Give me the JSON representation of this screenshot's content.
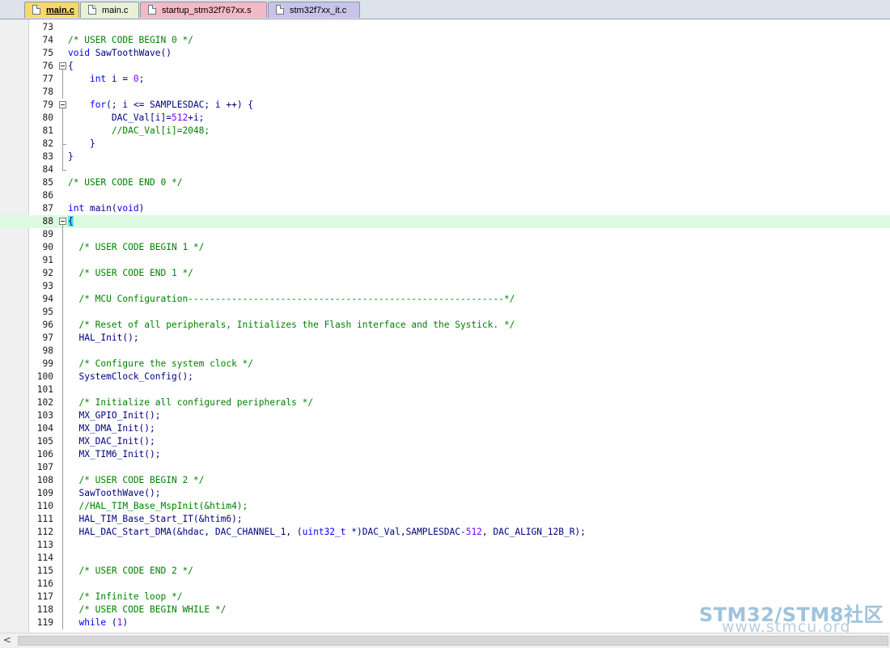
{
  "tabs": [
    {
      "label": "main.c",
      "active": true,
      "color": "#f6d96b"
    },
    {
      "label": "main.c",
      "active": false,
      "color": "#e8f1d6"
    },
    {
      "label": "startup_stm32f767xx.s",
      "active": false,
      "color": "#f4b9c6"
    },
    {
      "label": "stm32f7xx_it.c",
      "active": false,
      "color": "#c9c3ea"
    }
  ],
  "editor": {
    "current_line": 88,
    "lines": [
      {
        "n": "73",
        "t": ""
      },
      {
        "n": "74",
        "t": "/* USER CODE BEGIN 0 */"
      },
      {
        "n": "75",
        "t": "void SawToothWave()"
      },
      {
        "n": "76",
        "t": "{"
      },
      {
        "n": "77",
        "t": "    int i = 0;"
      },
      {
        "n": "78",
        "t": ""
      },
      {
        "n": "79",
        "t": "    for(; i <= SAMPLESDAC; i ++) {"
      },
      {
        "n": "80",
        "t": "        DAC_Val[i]=512+i;"
      },
      {
        "n": "81",
        "t": "        //DAC_Val[i]=2048;"
      },
      {
        "n": "82",
        "t": "    }"
      },
      {
        "n": "83",
        "t": "}"
      },
      {
        "n": "84",
        "t": ""
      },
      {
        "n": "85",
        "t": "/* USER CODE END 0 */"
      },
      {
        "n": "86",
        "t": ""
      },
      {
        "n": "87",
        "t": "int main(void)"
      },
      {
        "n": "88",
        "t": "{"
      },
      {
        "n": "89",
        "t": ""
      },
      {
        "n": "90",
        "t": "  /* USER CODE BEGIN 1 */"
      },
      {
        "n": "91",
        "t": ""
      },
      {
        "n": "92",
        "t": "  /* USER CODE END 1 */"
      },
      {
        "n": "93",
        "t": ""
      },
      {
        "n": "94",
        "t": "  /* MCU Configuration----------------------------------------------------------*/"
      },
      {
        "n": "95",
        "t": ""
      },
      {
        "n": "96",
        "t": "  /* Reset of all peripherals, Initializes the Flash interface and the Systick. */"
      },
      {
        "n": "97",
        "t": "  HAL_Init();"
      },
      {
        "n": "98",
        "t": ""
      },
      {
        "n": "99",
        "t": "  /* Configure the system clock */"
      },
      {
        "n": "100",
        "t": "  SystemClock_Config();"
      },
      {
        "n": "101",
        "t": ""
      },
      {
        "n": "102",
        "t": "  /* Initialize all configured peripherals */"
      },
      {
        "n": "103",
        "t": "  MX_GPIO_Init();"
      },
      {
        "n": "104",
        "t": "  MX_DMA_Init();"
      },
      {
        "n": "105",
        "t": "  MX_DAC_Init();"
      },
      {
        "n": "106",
        "t": "  MX_TIM6_Init();"
      },
      {
        "n": "107",
        "t": ""
      },
      {
        "n": "108",
        "t": "  /* USER CODE BEGIN 2 */"
      },
      {
        "n": "109",
        "t": "  SawToothWave();"
      },
      {
        "n": "110",
        "t": "  //HAL_TIM_Base_MspInit(&htim4);"
      },
      {
        "n": "111",
        "t": "  HAL_TIM_Base_Start_IT(&htim6);"
      },
      {
        "n": "112",
        "t": "  HAL_DAC_Start_DMA(&hdac, DAC_CHANNEL_1, (uint32_t *)DAC_Val,SAMPLESDAC-512, DAC_ALIGN_12B_R);"
      },
      {
        "n": "113",
        "t": ""
      },
      {
        "n": "114",
        "t": ""
      },
      {
        "n": "115",
        "t": "  /* USER CODE END 2 */"
      },
      {
        "n": "116",
        "t": ""
      },
      {
        "n": "117",
        "t": "  /* Infinite loop */"
      },
      {
        "n": "118",
        "t": "  /* USER CODE BEGIN WHILE */"
      },
      {
        "n": "119",
        "t": "  while (1)"
      }
    ]
  },
  "watermark": {
    "title": "STM32/STM8社区",
    "url": "www.stmcu.org"
  },
  "scrollbar": {
    "left_arrow": "<"
  }
}
